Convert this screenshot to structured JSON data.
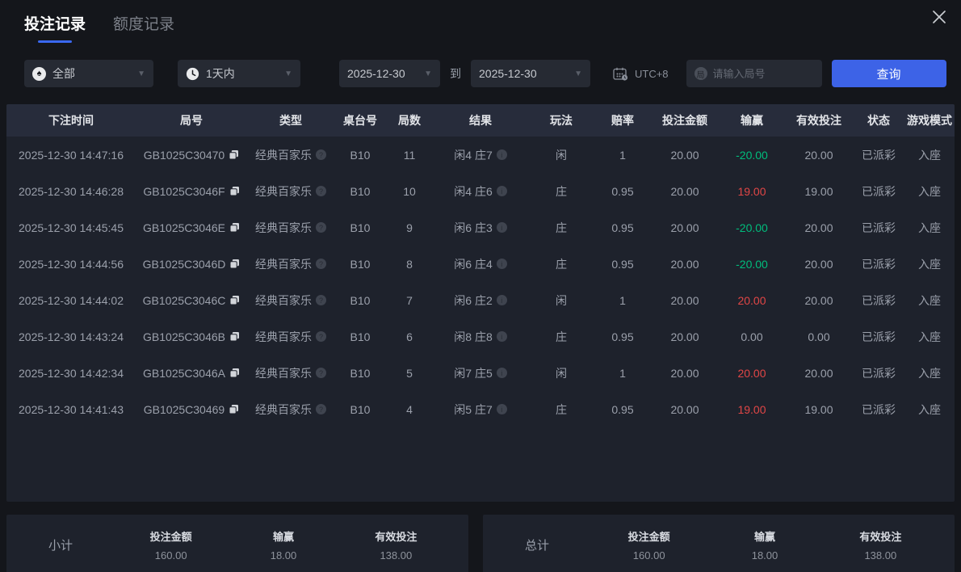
{
  "colors": {
    "accent_blue": "#3d63e7",
    "tab_underline": "#3a68f0",
    "win_red": "#e14646",
    "loss_green": "#00bd7c"
  },
  "tabs": [
    {
      "label": "投注记录",
      "active": true
    },
    {
      "label": "额度记录",
      "active": false
    }
  ],
  "filters": {
    "game_type": {
      "value": "全部",
      "icon": "spade"
    },
    "time_range": {
      "value": "1天内",
      "icon": "clock"
    },
    "date_from": "2025-12-30",
    "to_label": "到",
    "date_to": "2025-12-30",
    "timezone": "UTC+8",
    "round_input": {
      "placeholder": "请输入局号",
      "value": "",
      "icon_glyph": "局"
    },
    "search_button": "查询"
  },
  "table": {
    "columns": [
      "下注时间",
      "局号",
      "类型",
      "桌台号",
      "局数",
      "结果",
      "玩法",
      "赔率",
      "投注金额",
      "输赢",
      "有效投注",
      "状态",
      "游戏模式"
    ],
    "rows": [
      {
        "time": "2025-12-30 14:47:16",
        "round_id": "GB1025C30470",
        "game_type": "经典百家乐",
        "table_no": "B10",
        "round_count": "11",
        "result": "闲4 庄7",
        "play": "闲",
        "odds": "1",
        "bet_amount": "20.00",
        "win_loss": "-20.00",
        "win_loss_color": "green",
        "valid_bet": "20.00",
        "status": "已派彩",
        "mode": "入座"
      },
      {
        "time": "2025-12-30 14:46:28",
        "round_id": "GB1025C3046F",
        "game_type": "经典百家乐",
        "table_no": "B10",
        "round_count": "10",
        "result": "闲4 庄6",
        "play": "庄",
        "odds": "0.95",
        "bet_amount": "20.00",
        "win_loss": "19.00",
        "win_loss_color": "red",
        "valid_bet": "19.00",
        "status": "已派彩",
        "mode": "入座"
      },
      {
        "time": "2025-12-30 14:45:45",
        "round_id": "GB1025C3046E",
        "game_type": "经典百家乐",
        "table_no": "B10",
        "round_count": "9",
        "result": "闲6 庄3",
        "play": "庄",
        "odds": "0.95",
        "bet_amount": "20.00",
        "win_loss": "-20.00",
        "win_loss_color": "green",
        "valid_bet": "20.00",
        "status": "已派彩",
        "mode": "入座"
      },
      {
        "time": "2025-12-30 14:44:56",
        "round_id": "GB1025C3046D",
        "game_type": "经典百家乐",
        "table_no": "B10",
        "round_count": "8",
        "result": "闲6 庄4",
        "play": "庄",
        "odds": "0.95",
        "bet_amount": "20.00",
        "win_loss": "-20.00",
        "win_loss_color": "green",
        "valid_bet": "20.00",
        "status": "已派彩",
        "mode": "入座"
      },
      {
        "time": "2025-12-30 14:44:02",
        "round_id": "GB1025C3046C",
        "game_type": "经典百家乐",
        "table_no": "B10",
        "round_count": "7",
        "result": "闲6 庄2",
        "play": "闲",
        "odds": "1",
        "bet_amount": "20.00",
        "win_loss": "20.00",
        "win_loss_color": "red",
        "valid_bet": "20.00",
        "status": "已派彩",
        "mode": "入座"
      },
      {
        "time": "2025-12-30 14:43:24",
        "round_id": "GB1025C3046B",
        "game_type": "经典百家乐",
        "table_no": "B10",
        "round_count": "6",
        "result": "闲8 庄8",
        "play": "庄",
        "odds": "0.95",
        "bet_amount": "20.00",
        "win_loss": "0.00",
        "win_loss_color": "neutral",
        "valid_bet": "0.00",
        "status": "已派彩",
        "mode": "入座"
      },
      {
        "time": "2025-12-30 14:42:34",
        "round_id": "GB1025C3046A",
        "game_type": "经典百家乐",
        "table_no": "B10",
        "round_count": "5",
        "result": "闲7 庄5",
        "play": "闲",
        "odds": "1",
        "bet_amount": "20.00",
        "win_loss": "20.00",
        "win_loss_color": "red",
        "valid_bet": "20.00",
        "status": "已派彩",
        "mode": "入座"
      },
      {
        "time": "2025-12-30 14:41:43",
        "round_id": "GB1025C30469",
        "game_type": "经典百家乐",
        "table_no": "B10",
        "round_count": "4",
        "result": "闲5 庄7",
        "play": "庄",
        "odds": "0.95",
        "bet_amount": "20.00",
        "win_loss": "19.00",
        "win_loss_color": "red",
        "valid_bet": "19.00",
        "status": "已派彩",
        "mode": "入座"
      }
    ]
  },
  "summary": {
    "subtotal": {
      "label": "小计",
      "bet_amount_label": "投注金额",
      "bet_amount": "160.00",
      "win_loss_label": "输赢",
      "win_loss": "18.00",
      "valid_bet_label": "有效投注",
      "valid_bet": "138.00"
    },
    "total": {
      "label": "总计",
      "bet_amount_label": "投注金额",
      "bet_amount": "160.00",
      "win_loss_label": "输赢",
      "win_loss": "18.00",
      "valid_bet_label": "有效投注",
      "valid_bet": "138.00"
    }
  }
}
